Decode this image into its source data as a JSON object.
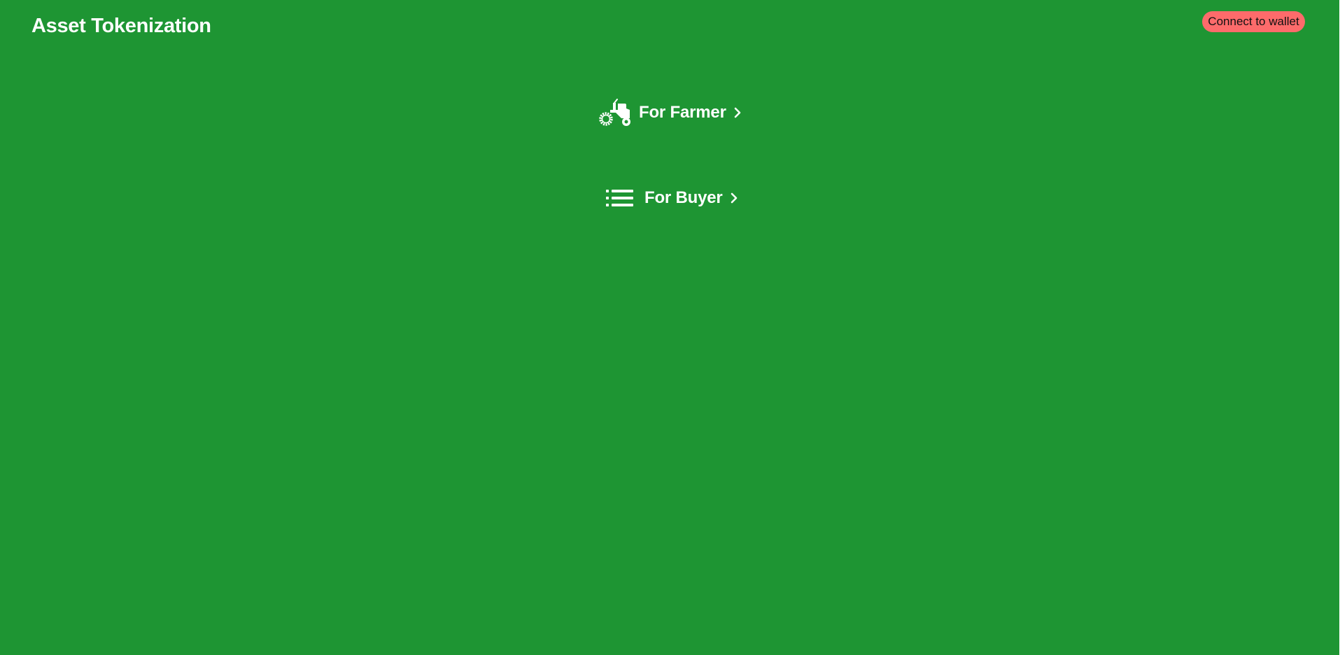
{
  "header": {
    "title": "Asset Tokenization",
    "connect_label": "Connect to wallet"
  },
  "nav": {
    "farmer": {
      "label": "For Farmer",
      "icon": "tractor-icon"
    },
    "buyer": {
      "label": "For Buyer",
      "icon": "list-icon"
    }
  },
  "colors": {
    "background": "#1e9533",
    "button": "#fd6b6b",
    "text": "#ffffff"
  }
}
